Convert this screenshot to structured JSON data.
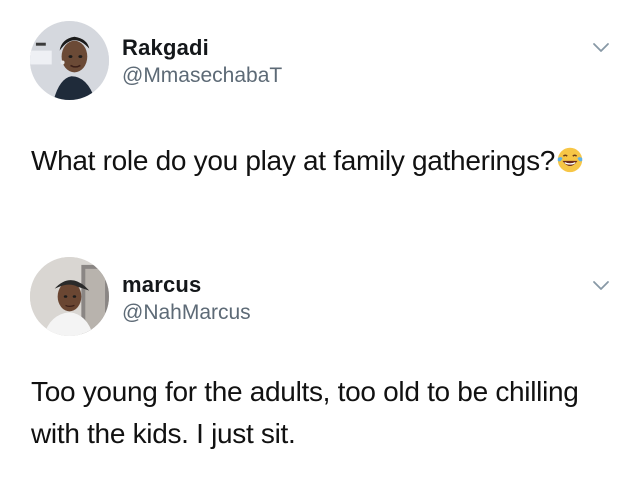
{
  "tweets": [
    {
      "display_name": "Rakgadi",
      "handle": "@MmasechabaT",
      "text": "What role do you play at family gatherings?",
      "emoji": "face-with-tears-of-joy-icon"
    },
    {
      "display_name": "marcus",
      "handle": "@NahMarcus",
      "text": "Too young for the adults, too old to be chilling with the kids. I just sit."
    }
  ],
  "colors": {
    "text": "#111111",
    "name": "#14171a",
    "handle": "#5d6a76",
    "chevron": "#8899a6"
  }
}
